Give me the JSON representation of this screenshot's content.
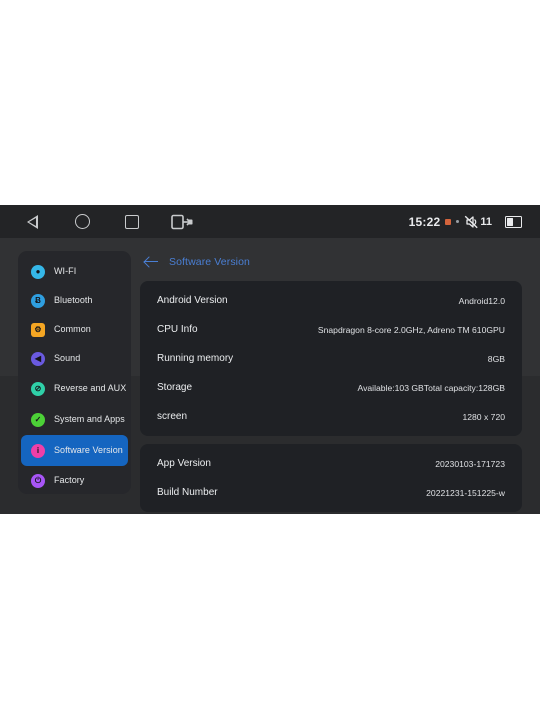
{
  "statusbar": {
    "clock": "15:22",
    "volume_level": "11",
    "icons": {
      "back": "back-triangle-icon",
      "home": "home-circle-icon",
      "recents": "recents-square-icon",
      "exit": "exit-screen-icon",
      "alert": "orange-square-icon",
      "dot": "small-dot-icon",
      "mute": "volume-muted-icon",
      "battery": "battery-icon"
    }
  },
  "sidebar": {
    "items": [
      {
        "label": "WI-FI",
        "icon": "wifi-icon",
        "color": "#35b7e8",
        "glyph": "●",
        "selected": false
      },
      {
        "label": "Bluetooth",
        "icon": "bluetooth-icon",
        "color": "#2f9fe0",
        "glyph": "Ƀ",
        "selected": false
      },
      {
        "label": "Common",
        "icon": "gear-icon",
        "color": "#f5a623",
        "glyph": "⚙",
        "selected": false,
        "shape": "square"
      },
      {
        "label": "Sound",
        "icon": "speaker-icon",
        "color": "#6a5ae0",
        "glyph": "◀",
        "selected": false
      },
      {
        "label": "Reverse and AUX",
        "icon": "reverse-aux-icon",
        "color": "#2fd0a8",
        "glyph": "⊘",
        "selected": false
      },
      {
        "label": "System and Apps",
        "icon": "system-apps-icon",
        "color": "#4cd137",
        "glyph": "✓",
        "selected": false
      },
      {
        "label": "Software Version",
        "icon": "info-icon",
        "color": "#ef3fa8",
        "glyph": "i",
        "selected": true
      },
      {
        "label": "Factory",
        "icon": "factory-icon",
        "color": "#a855f7",
        "glyph": "⏻",
        "selected": false
      }
    ]
  },
  "main": {
    "title": "Software Version",
    "back_icon": "back-arrow-icon",
    "cards": [
      {
        "rows": [
          {
            "label": "Android Version",
            "value": "Android12.0"
          },
          {
            "label": "CPU Info",
            "value": "Snapdragon 8-core 2.0GHz, Adreno TM 610GPU"
          },
          {
            "label": "Running memory",
            "value": "8GB"
          },
          {
            "label": "Storage",
            "value": "Available:103 GBTotal capacity:128GB"
          },
          {
            "label": "screen",
            "value": "1280 x 720"
          }
        ]
      },
      {
        "rows": [
          {
            "label": "App Version",
            "value": "20230103-171723"
          },
          {
            "label": "Build Number",
            "value": "20221231-151225-w"
          }
        ]
      }
    ]
  },
  "colors": {
    "accent_blue": "#1565c0",
    "title_blue": "#4a7fd4",
    "card_bg": "#1f2125",
    "sidebar_bg": "#26272b",
    "page_bg": "#313234",
    "navbar_bg": "#232426"
  }
}
